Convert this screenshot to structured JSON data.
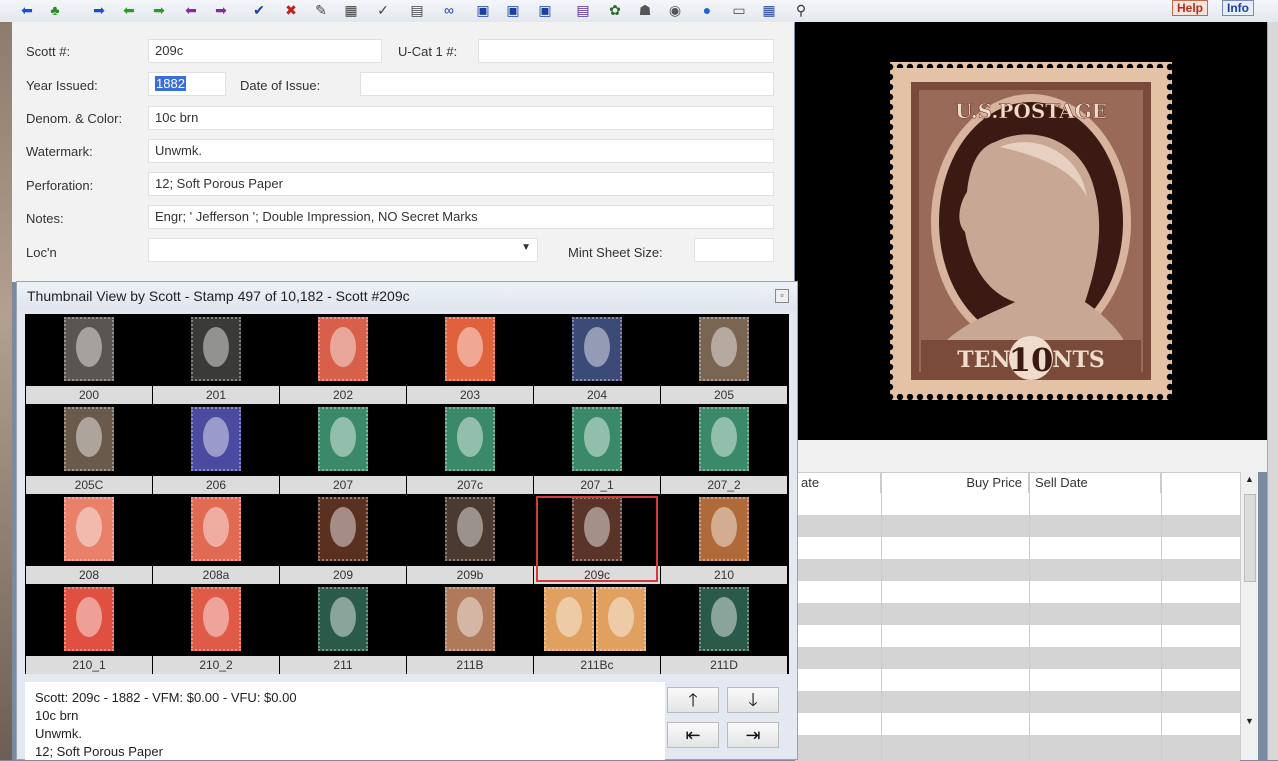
{
  "toolbar": {
    "icons": [
      "arrow-left-icon",
      "tree-icon",
      "arrow-right-icon",
      "green-left-icon",
      "green-right-icon",
      "purple-left-icon",
      "purple-right-icon",
      "check-icon",
      "cross-icon",
      "pen-icon",
      "grid-edit-icon",
      "check-x-icon",
      "grid-x-icon",
      "binoculars-icon",
      "doc1-icon",
      "doc2-icon",
      "doc3-icon",
      "book-icon",
      "people-icon",
      "users-icon",
      "globe-icon",
      "drop-icon",
      "monitor-icon",
      "table-icon",
      "pin-icon"
    ],
    "help_label": "Help",
    "info_label": "Info"
  },
  "form": {
    "scott_label": "Scott #:",
    "scott_value": "209c",
    "ucat_label": "U-Cat 1 #:",
    "ucat_value": "",
    "year_label": "Year Issued:",
    "year_value": "1882",
    "date_label": "Date of Issue:",
    "date_value": "",
    "denom_label": "Denom. & Color:",
    "denom_value": "10c brn",
    "watermark_label": "Watermark:",
    "watermark_value": "Unwmk.",
    "perf_label": "Perforation:",
    "perf_value": "12; Soft Porous Paper",
    "notes_label": "Notes:",
    "notes_value": "Engr; ' Jefferson '; Double Impression, NO Secret Marks",
    "loc_label": "Loc'n",
    "loc_value": "",
    "mint_label": "Mint Sheet Size:",
    "mint_value": ""
  },
  "stamp_image": {
    "top_text": "U.S.POSTAGE",
    "bottom_text": "TEN CENTS",
    "numeral": "10"
  },
  "grid": {
    "headers": [
      "ate",
      "Buy Price",
      "Sell Date",
      ""
    ]
  },
  "thumbnail_window": {
    "title": "Thumbnail View by Scott - Stamp 497 of 10,182 - Scott #209c",
    "rows": [
      [
        {
          "label": "200",
          "color": "#5a5550"
        },
        {
          "label": "201",
          "color": "#3a3a38"
        },
        {
          "label": "202",
          "color": "#d8604a"
        },
        {
          "label": "203",
          "color": "#e0623c"
        },
        {
          "label": "204",
          "color": "#3c4a78"
        },
        {
          "label": "205",
          "color": "#7a6452"
        }
      ],
      [
        {
          "label": "205C",
          "color": "#6a5a4c"
        },
        {
          "label": "206",
          "color": "#4a4aa0"
        },
        {
          "label": "207",
          "color": "#3a8a6a"
        },
        {
          "label": "207c",
          "color": "#3a8a6a"
        },
        {
          "label": "207_1",
          "color": "#3a8a6a"
        },
        {
          "label": "207_2",
          "color": "#3a8a6a"
        }
      ],
      [
        {
          "label": "208",
          "color": "#e8806a"
        },
        {
          "label": "208a",
          "color": "#e06a52"
        },
        {
          "label": "209",
          "color": "#5a3020"
        },
        {
          "label": "209b",
          "color": "#4a3a30"
        },
        {
          "label": "209c",
          "color": "#5a3428"
        },
        {
          "label": "210",
          "color": "#b06a3a"
        }
      ],
      [
        {
          "label": "210_1",
          "color": "#e05040"
        },
        {
          "label": "210_2",
          "color": "#e05a48"
        },
        {
          "label": "211",
          "color": "#2a5a4a"
        },
        {
          "label": "211B",
          "color": "#b07a5a"
        },
        {
          "label": "211Bc",
          "color": "#e0a060"
        },
        {
          "label": "211D",
          "color": "#2a5a4a"
        }
      ]
    ],
    "selected": "209c",
    "info_lines": [
      "Scott: 209c - 1882 - VFM: $0.00 - VFU: $0.00",
      "10c brn",
      "Unwmk.",
      "12; Soft Porous Paper"
    ],
    "nav": {
      "up": "🡑",
      "down": "🡓",
      "first": "⇤",
      "last": "⇥"
    }
  }
}
